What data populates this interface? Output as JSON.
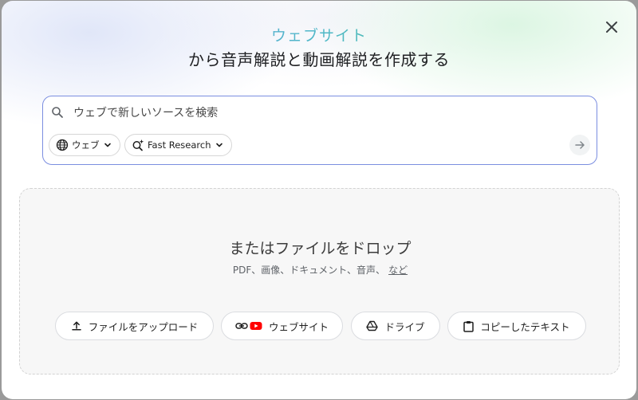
{
  "dialog": {
    "title_accent": "ウェブサイト",
    "title_main": "から音声解説と動画解説を作成する"
  },
  "search": {
    "placeholder": "ウェブで新しいソースを検索",
    "value": "",
    "source_chip_label": "ウェブ",
    "mode_chip_label": "Fast Research"
  },
  "dropzone": {
    "title": "またはファイルをドロップ",
    "subtitle": "PDF、画像、ドキュメント、音声、",
    "more_link": "など"
  },
  "sources": {
    "upload_label": "ファイルをアップロード",
    "website_label": "ウェブサイト",
    "drive_label": "ドライブ",
    "paste_label": "コピーしたテキスト"
  },
  "icons": [
    "close-icon",
    "search-icon",
    "globe-icon",
    "research-icon",
    "chevron-down-icon",
    "arrow-right-icon",
    "upload-icon",
    "link-icon",
    "youtube-icon",
    "drive-icon",
    "clipboard-icon"
  ],
  "colors": {
    "accent_border": "#7b8ee0",
    "youtube_red": "#ff0000"
  }
}
